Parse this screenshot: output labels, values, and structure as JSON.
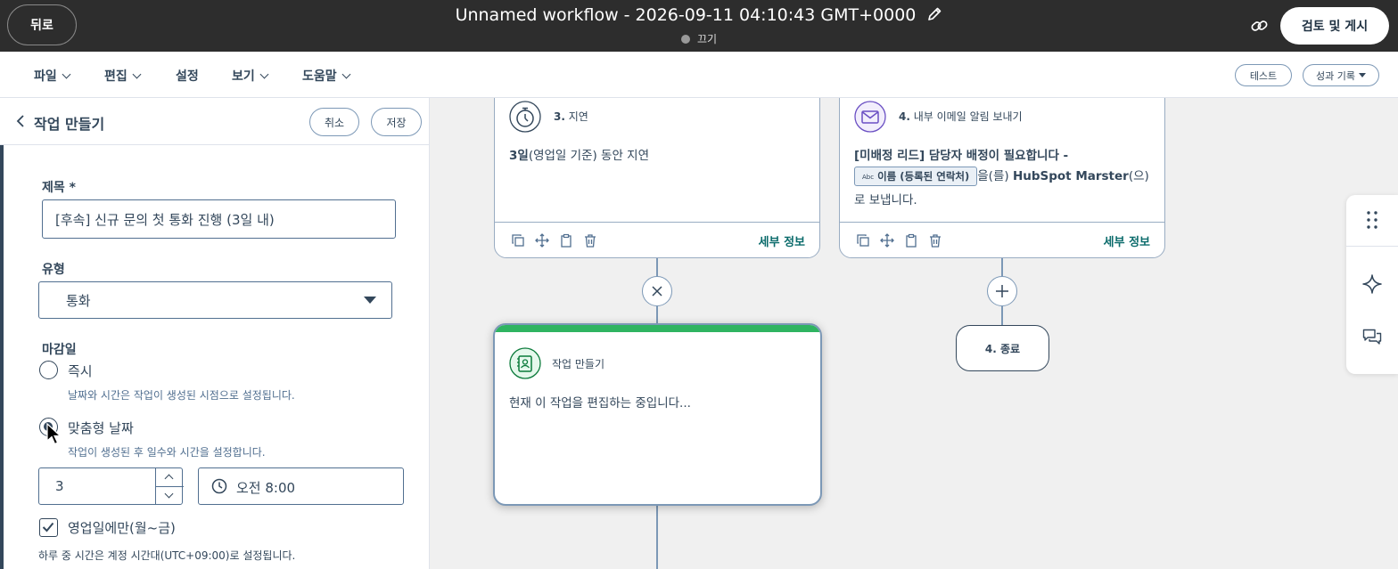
{
  "topbar": {
    "back_label": "뒤로",
    "workflow_title": "Unnamed workflow - 2026-09-11 04:10:43 GMT+0000",
    "status_label": "끄기",
    "publish_label": "검토 및 게시"
  },
  "menubar": {
    "items": [
      "파일",
      "편집",
      "설정",
      "보기",
      "도움말"
    ],
    "test_label": "테스트",
    "performance_label": "성과 기록"
  },
  "panel": {
    "title": "작업 만들기",
    "cancel_label": "취소",
    "save_label": "저장",
    "title_label": "제목 *",
    "title_value": "[후속] 신규 문의 첫 통화 진행 (3일 내)",
    "type_label": "유형",
    "type_value": "통화",
    "due_label": "마감일",
    "option_immediate": "즉시",
    "option_immediate_help": "날짜와 시간은 작업이 생성된 시점으로 설정됩니다.",
    "option_custom": "맞춤형 날짜",
    "option_custom_help": "작업이 생성된 후 일수와 시간을 설정합니다.",
    "days_value": "3",
    "time_value": "오전 8:00",
    "business_days_label": "영업일에만(월~금)",
    "timezone_note": "하루 중 시간은 계정 시간대(UTC+09:00)로 설정됩니다."
  },
  "canvas": {
    "delay_card": {
      "step_num": "3.",
      "step_name": "지연",
      "body_bold": "3일",
      "body_rest": "(영업일 기준) 동안 지연",
      "details": "세부 정보"
    },
    "email_card": {
      "step_num": "4.",
      "step_name": "내부 이메일 알림 보내기",
      "body_line1": "[미배정 리드] 담당자 배정이 필요합니다 -",
      "token_prefix": "Abc",
      "token_label": "이름 (등록된 연락처)",
      "body_mid": "을(를)",
      "body_recipient": "HubSpot Marster",
      "body_after": "(으)",
      "body_line3": "로 보냅니다.",
      "details": "세부 정보"
    },
    "editing_card": {
      "title": "작업 만들기",
      "body": "현재 이 작업을 편집하는 중입니다..."
    },
    "end_node": "4. 종료"
  },
  "colors": {
    "topbar_bg": "#2d2d2d",
    "accent_green": "#2fb461",
    "link_teal": "#0b6b6b",
    "email_purple": "#6a4fc3"
  }
}
